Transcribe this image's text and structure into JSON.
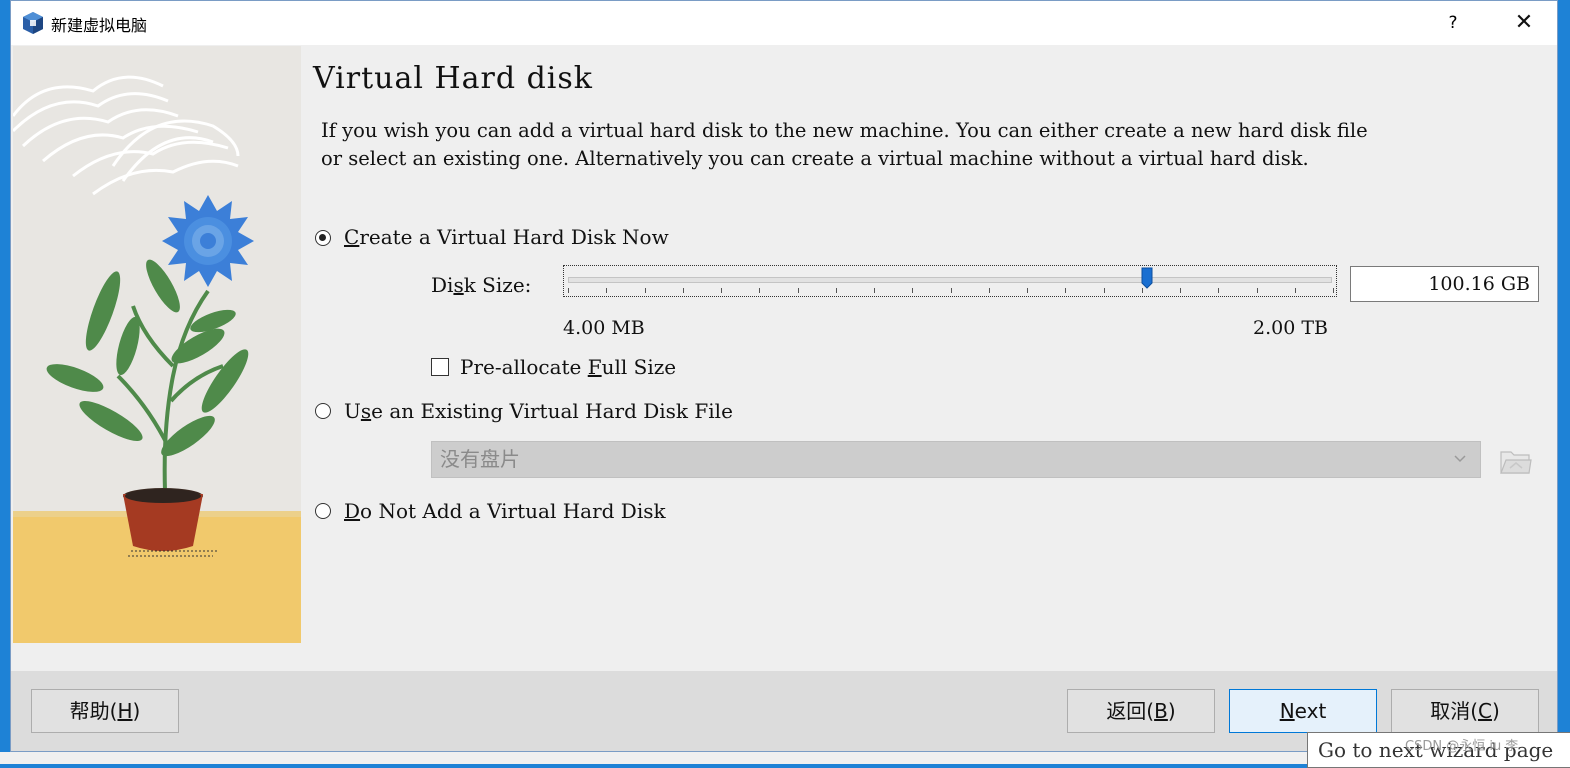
{
  "window": {
    "title": "新建虚拟电脑",
    "help_glyph": "?",
    "close_glyph": "✕"
  },
  "page": {
    "title": "Virtual Hard disk",
    "description": "If you wish you can add a virtual hard disk to the new machine. You can either create a new hard disk file or select an existing one. Alternatively you can create a virtual machine without a virtual hard disk."
  },
  "options": {
    "create_now": {
      "prefix": "C",
      "rest": "reate a Virtual Hard Disk Now",
      "selected": true
    },
    "use_existing": {
      "pre": "U",
      "mnemonic": "s",
      "rest": "e an Existing Virtual Hard Disk File",
      "selected": false
    },
    "do_not_add": {
      "prefix": "D",
      "rest": "o Not Add a Virtual Hard Disk",
      "selected": false
    }
  },
  "disk_size": {
    "label_pre": "Di",
    "label_mnemonic": "s",
    "label_rest": "k Size:",
    "value": "100.16 GB",
    "min_label": "4.00 MB",
    "max_label": "2.00 TB",
    "slider_fraction": 0.76
  },
  "preallocate": {
    "pre": "Pre-allocate ",
    "mnemonic": "F",
    "rest": "ull Size",
    "checked": false
  },
  "existing_disk": {
    "selected": "没有盘片"
  },
  "footer": {
    "help_label": "帮助(",
    "help_key": "H",
    "back_label": "返回(",
    "back_key": "B",
    "next_key": "N",
    "next_rest": "ext",
    "cancel_label": "取消(",
    "cancel_key": "C",
    "close_paren": ")"
  },
  "tooltip": "Go to next wizard page",
  "watermark": "CSDN @永恒 iu 李",
  "colors": {
    "accent": "#0078d7",
    "slider_handle": "#1a6fd1",
    "flower": "#3c7fd8",
    "leaf": "#4f8a4a",
    "pot": "#a53a22",
    "table": "#f1c96c"
  }
}
